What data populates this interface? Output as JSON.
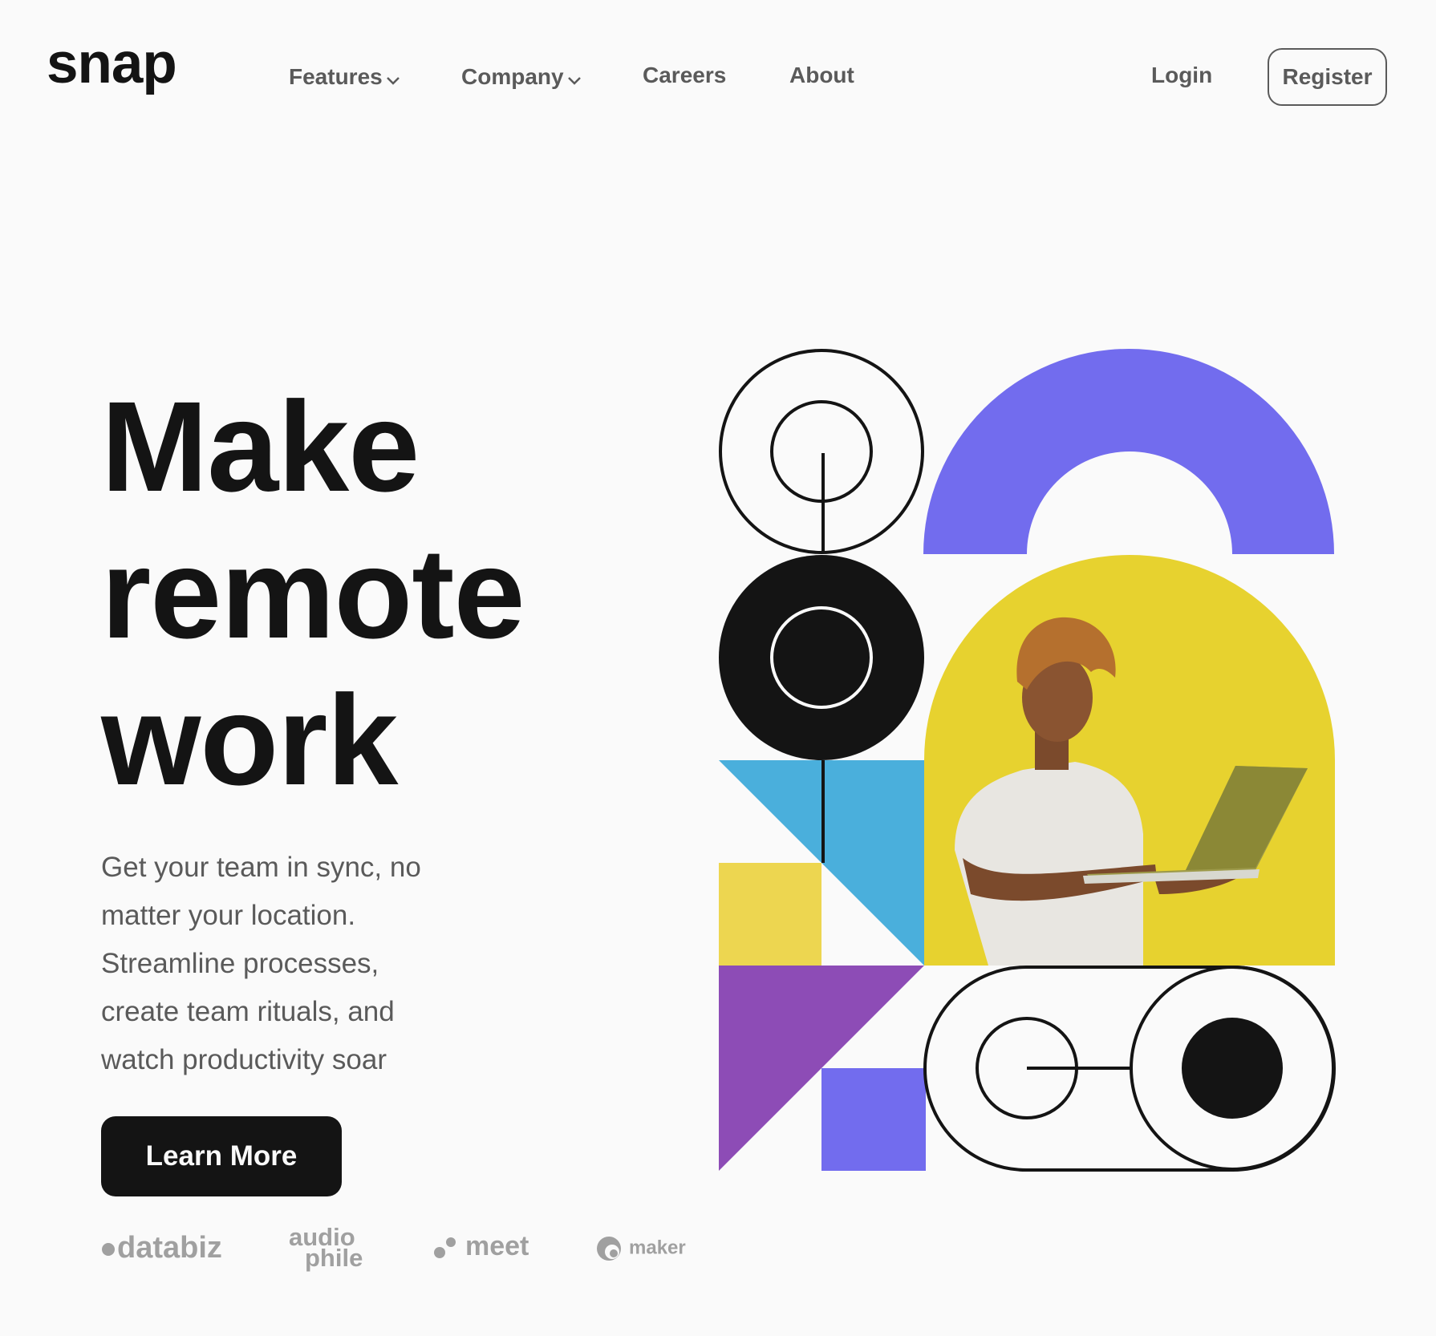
{
  "brand": {
    "logo": "snap"
  },
  "nav": {
    "features": "Features",
    "company": "Company",
    "careers": "Careers",
    "about": "About",
    "login": "Login",
    "register": "Register"
  },
  "hero": {
    "headline_line1": "Make",
    "headline_line2": "remote",
    "headline_line3": "work",
    "description_line1": "Get your team in sync, no",
    "description_line2": "matter your location.",
    "description_line3": "Streamline processes,",
    "description_line4": "create team rituals, and",
    "description_line5": "watch productivity soar",
    "cta_label": "Learn More"
  },
  "clients": {
    "databiz": "databiz",
    "audiophile_top": "audio",
    "audiophile_bottom": "phile",
    "meet": "meet",
    "maker": "maker"
  },
  "colors": {
    "text_dark": "#141414",
    "text_gray": "#5a5a5a",
    "logo_gray": "#a0a0a0",
    "purple": "#726cee",
    "yellow": "#edd650",
    "blue": "#4aafdc",
    "violet": "#8d4cb6",
    "photo_bg": "#e7d22f"
  },
  "icons": {
    "features_dropdown": "chevron-down-icon",
    "company_dropdown": "chevron-down-icon"
  }
}
